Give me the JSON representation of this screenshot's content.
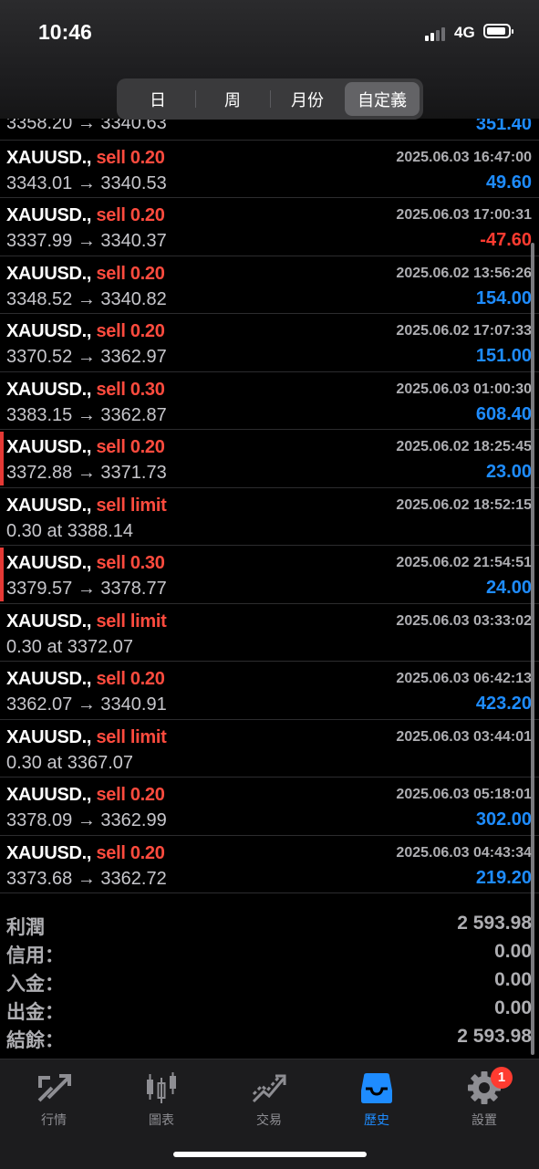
{
  "status": {
    "time": "10:46",
    "network": "4G"
  },
  "segment": [
    "日",
    "周",
    "月份",
    "自定義"
  ],
  "orders": [
    {
      "symbol": "",
      "side": "",
      "time": "",
      "prices": "3358.20 → 3340.63",
      "profit": "351.40",
      "neg": false,
      "marked": false,
      "first": true
    },
    {
      "symbol": "XAUUSD.,",
      "side": "sell 0.20",
      "time": "2025.06.03 16:47:00",
      "prices": "3343.01 → 3340.53",
      "profit": "49.60",
      "neg": false,
      "marked": false
    },
    {
      "symbol": "XAUUSD.,",
      "side": "sell 0.20",
      "time": "2025.06.03 17:00:31",
      "prices": "3337.99 → 3340.37",
      "profit": "-47.60",
      "neg": true,
      "marked": false
    },
    {
      "symbol": "XAUUSD.,",
      "side": "sell 0.20",
      "time": "2025.06.02 13:56:26",
      "prices": "3348.52 → 3340.82",
      "profit": "154.00",
      "neg": false,
      "marked": false
    },
    {
      "symbol": "XAUUSD.,",
      "side": "sell 0.20",
      "time": "2025.06.02 17:07:33",
      "prices": "3370.52 → 3362.97",
      "profit": "151.00",
      "neg": false,
      "marked": false
    },
    {
      "symbol": "XAUUSD.,",
      "side": "sell 0.30",
      "time": "2025.06.03 01:00:30",
      "prices": "3383.15 → 3362.87",
      "profit": "608.40",
      "neg": false,
      "marked": false
    },
    {
      "symbol": "XAUUSD.,",
      "side": "sell 0.20",
      "time": "2025.06.02 18:25:45",
      "prices": "3372.88 → 3371.73",
      "profit": "23.00",
      "neg": false,
      "marked": true
    },
    {
      "symbol": "XAUUSD.,",
      "side": "sell limit",
      "time": "2025.06.02 18:52:15",
      "prices": "0.30 at 3388.14",
      "profit": "",
      "neg": false,
      "marked": false
    },
    {
      "symbol": "XAUUSD.,",
      "side": "sell 0.30",
      "time": "2025.06.02 21:54:51",
      "prices": "3379.57 → 3378.77",
      "profit": "24.00",
      "neg": false,
      "marked": true
    },
    {
      "symbol": "XAUUSD.,",
      "side": "sell limit",
      "time": "2025.06.03 03:33:02",
      "prices": "0.30 at 3372.07",
      "profit": "",
      "neg": false,
      "marked": false
    },
    {
      "symbol": "XAUUSD.,",
      "side": "sell 0.20",
      "time": "2025.06.03 06:42:13",
      "prices": "3362.07 → 3340.91",
      "profit": "423.20",
      "neg": false,
      "marked": false
    },
    {
      "symbol": "XAUUSD.,",
      "side": "sell limit",
      "time": "2025.06.03 03:44:01",
      "prices": "0.30 at 3367.07",
      "profit": "",
      "neg": false,
      "marked": false
    },
    {
      "symbol": "XAUUSD.,",
      "side": "sell 0.20",
      "time": "2025.06.03 05:18:01",
      "prices": "3378.09 → 3362.99",
      "profit": "302.00",
      "neg": false,
      "marked": false
    },
    {
      "symbol": "XAUUSD.,",
      "side": "sell 0.20",
      "time": "2025.06.03 04:43:34",
      "prices": "3373.68 → 3362.72",
      "profit": "219.20",
      "neg": false,
      "marked": false
    }
  ],
  "summary": [
    {
      "label": "利潤",
      "value": "2 593.98"
    },
    {
      "label": "信用：",
      "value": "0.00"
    },
    {
      "label": "入金：",
      "value": "0.00"
    },
    {
      "label": "出金：",
      "value": "0.00"
    },
    {
      "label": "結餘：",
      "value": "2 593.98"
    }
  ],
  "tabs": [
    {
      "label": "行情",
      "icon": "quotes-icon",
      "active": false
    },
    {
      "label": "圖表",
      "icon": "chart-icon",
      "active": false
    },
    {
      "label": "交易",
      "icon": "trade-icon",
      "active": false
    },
    {
      "label": "歷史",
      "icon": "history-icon",
      "active": true
    },
    {
      "label": "設置",
      "icon": "settings-icon",
      "active": false,
      "badge": "1"
    }
  ],
  "colors": {
    "profit": "#1e8cff",
    "loss": "#ff3b30",
    "sell": "#ff4b3e",
    "active_tab": "#1e8cff"
  }
}
